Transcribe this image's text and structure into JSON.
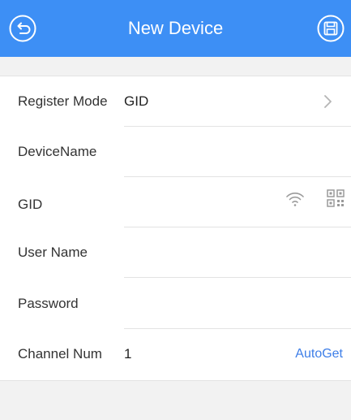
{
  "header": {
    "title": "New Device"
  },
  "form": {
    "register_mode": {
      "label": "Register Mode",
      "value": "GID"
    },
    "device_name": {
      "label": "DeviceName",
      "value": ""
    },
    "gid": {
      "label": "GID",
      "value": ""
    },
    "user_name": {
      "label": "User Name",
      "value": ""
    },
    "password": {
      "label": "Password",
      "value": ""
    },
    "channel_num": {
      "label": "Channel Num",
      "value": "1",
      "action": "AutoGet"
    }
  },
  "colors": {
    "header_bg": "#3d8ff5",
    "accent": "#3d7ee8",
    "page_bg": "#f2f2f2"
  },
  "icons": [
    "back-icon",
    "save-icon",
    "chevron-right-icon",
    "wifi-icon",
    "qr-code-icon"
  ]
}
